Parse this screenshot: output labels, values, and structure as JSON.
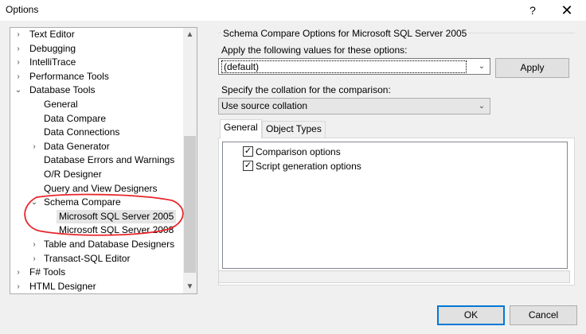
{
  "window": {
    "title": "Options",
    "help_glyph": "?",
    "close_glyph": "✕"
  },
  "tree": {
    "items": [
      {
        "label": "Text Editor",
        "chevron": "›"
      },
      {
        "label": "Debugging",
        "chevron": "›"
      },
      {
        "label": "IntelliTrace",
        "chevron": "›"
      },
      {
        "label": "Performance Tools",
        "chevron": "›"
      },
      {
        "label": "Database Tools",
        "chevron": "⌄"
      },
      {
        "label": "General",
        "chevron": ""
      },
      {
        "label": "Data Compare",
        "chevron": ""
      },
      {
        "label": "Data Connections",
        "chevron": ""
      },
      {
        "label": "Data Generator",
        "chevron": "›"
      },
      {
        "label": "Database Errors and Warnings",
        "chevron": ""
      },
      {
        "label": "O/R Designer",
        "chevron": ""
      },
      {
        "label": "Query and View Designers",
        "chevron": ""
      },
      {
        "label": "Schema Compare",
        "chevron": "⌄"
      },
      {
        "label": "Microsoft SQL Server 2005",
        "chevron": "",
        "selected": true
      },
      {
        "label": "Microsoft SQL Server 2008",
        "chevron": ""
      },
      {
        "label": "Table and Database Designers",
        "chevron": "›"
      },
      {
        "label": "Transact-SQL Editor",
        "chevron": "›"
      },
      {
        "label": "F# Tools",
        "chevron": "›"
      },
      {
        "label": "HTML Designer",
        "chevron": "›"
      }
    ],
    "scroll_up_glyph": "▲",
    "scroll_down_glyph": "▼",
    "annotation_color": "#e8262b"
  },
  "panel": {
    "group_title": "Schema Compare Options for Microsoft SQL Server 2005",
    "apply_label": "Apply the following values for these options:",
    "apply_value": "(default)",
    "apply_button": "Apply",
    "collation_label": "Specify the collation for the comparison:",
    "collation_value": "Use source collation",
    "dropdown_glyph": "⌄",
    "tabs": [
      {
        "label": "General",
        "active": true
      },
      {
        "label": "Object Types",
        "active": false
      }
    ],
    "options": [
      {
        "label": "Comparison options",
        "checked": true
      },
      {
        "label": "Script generation options",
        "checked": true
      }
    ],
    "check_glyph": "✓"
  },
  "footer": {
    "ok_label": "OK",
    "cancel_label": "Cancel"
  },
  "colors": {
    "accent": "#0078d7",
    "window_bg": "#f0f0f0"
  }
}
